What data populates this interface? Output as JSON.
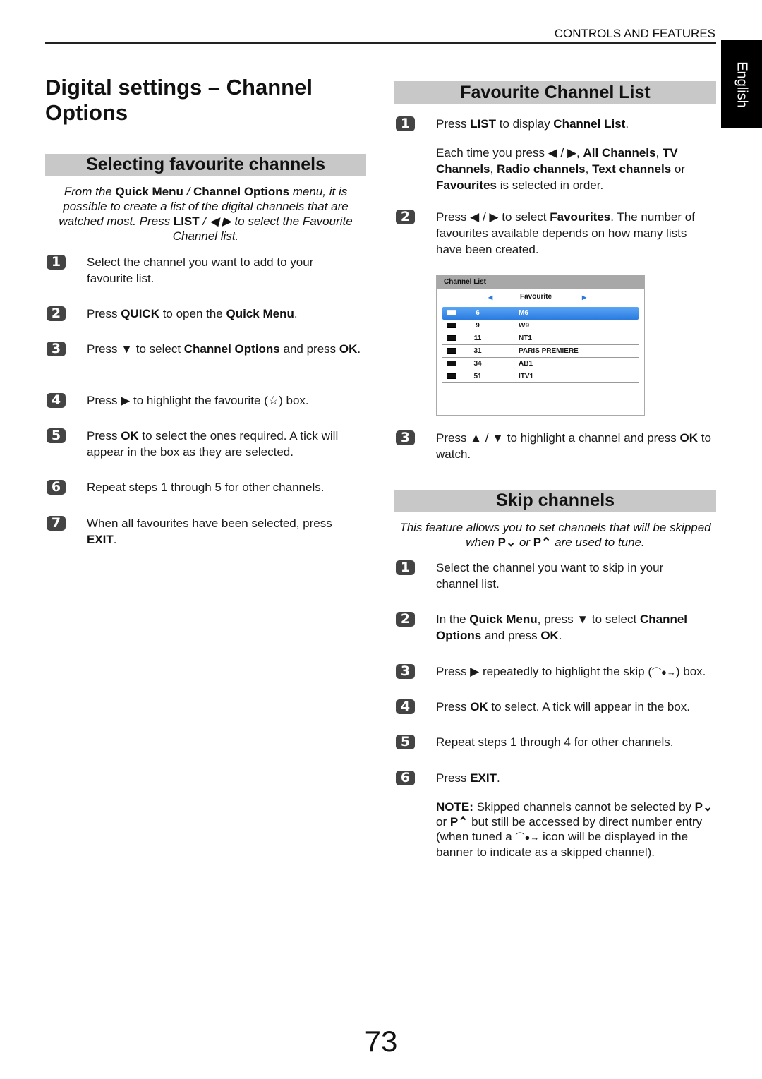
{
  "header": {
    "section_label": "CONTROLS AND FEATURES",
    "language_tab": "English"
  },
  "page_title": "Digital settings – Channel Options",
  "left": {
    "heading": "Selecting favourite channels",
    "intro": {
      "p1": "From the ",
      "b1": "Quick Menu",
      "p2": " / ",
      "b2": "Channel Options",
      "p3": " menu, it is possible to create a list of the digital channels that are watched most. Press ",
      "b3": "LIST",
      "p4": " / ◀ ▶ to select the Favourite Channel list."
    },
    "steps": [
      {
        "n": "1",
        "text": "Select the channel you want to add to your favourite list."
      },
      {
        "n": "2",
        "p1": "Press ",
        "b1": "QUICK",
        "p2": " to open the ",
        "b2": "Quick Menu",
        "p3": "."
      },
      {
        "n": "3",
        "p1": "Press ▼ to select ",
        "b1": "Channel Options",
        "p2": " and press ",
        "b2": "OK",
        "p3": "."
      },
      {
        "n": "4",
        "text": "Press ▶ to highlight the favourite (☆) box."
      },
      {
        "n": "5",
        "p1": "Press ",
        "b1": "OK",
        "p2": " to select the ones required. A tick will appear in the box as they are selected."
      },
      {
        "n": "6",
        "text": "Repeat steps 1 through 5 for other channels."
      },
      {
        "n": "7",
        "p1": "When all favourites have been selected, press ",
        "b1": "EXIT",
        "p2": "."
      }
    ]
  },
  "favourite": {
    "heading": "Favourite Channel List",
    "steps": [
      {
        "n": "1",
        "p1": "Press ",
        "b1": "LIST",
        "p2": " to display ",
        "b2": "Channel List",
        "p3": "."
      },
      {
        "extra": true,
        "p1": "Each time you press ◀ / ▶, ",
        "b1": "All Channels",
        "p2": ", ",
        "b2": "TV Channels",
        "p3": ", ",
        "b3": "Radio channels",
        "p4": ", ",
        "b4": "Text channels",
        "p5": " or ",
        "b5": "Favourites",
        "p6": " is selected in order."
      },
      {
        "n": "2",
        "p1": "Press ◀ / ▶ to select ",
        "b1": "Favourites",
        "p2": ". The number of favourites available depends on how many lists have been created."
      },
      {
        "n": "3",
        "p1": "Press ▲ / ▼ to highlight a channel and press ",
        "b1": "OK",
        "p2": " to watch."
      }
    ],
    "channel_list": {
      "title": "Channel List",
      "filter": "Favourite",
      "rows": [
        {
          "number": "6",
          "name": "M6",
          "selected": true
        },
        {
          "number": "9",
          "name": "W9"
        },
        {
          "number": "11",
          "name": "NT1"
        },
        {
          "number": "31",
          "name": "PARIS PREMIERE"
        },
        {
          "number": "34",
          "name": "AB1"
        },
        {
          "number": "51",
          "name": "ITV1"
        }
      ]
    }
  },
  "skip": {
    "heading": "Skip channels",
    "intro": {
      "p1": "This feature allows you to set channels that will be skipped when ",
      "b1": "P⌄",
      "p2": " or ",
      "b2": "P⌃",
      "p3": " are used to tune."
    },
    "steps": [
      {
        "n": "1",
        "text": "Select the channel you want to skip in your channel list."
      },
      {
        "n": "2",
        "p1": "In the ",
        "b1": "Quick Menu",
        "p2": ", press ▼ to select ",
        "b2": "Channel Options",
        "p3": " and press ",
        "b3": "OK",
        "p4": "."
      },
      {
        "n": "3",
        "p1": "Press ▶ repeatedly to highlight the skip (",
        "icon": "skip-icon",
        "p2": ") box."
      },
      {
        "n": "4",
        "p1": "Press ",
        "b1": "OK",
        "p2": " to select. A tick will appear in the box."
      },
      {
        "n": "5",
        "text": "Repeat steps 1 through 4 for other channels."
      },
      {
        "n": "6",
        "p1": "Press ",
        "b1": "EXIT",
        "p2": "."
      }
    ],
    "note": {
      "label": "NOTE:",
      "p1": " Skipped channels cannot be selected by ",
      "b1": "P⌄",
      "p2": " or ",
      "b2": "P⌃",
      "p3": " but still be accessed by direct number entry (when tuned a ",
      "p4": " icon will be displayed in the banner to indicate as a skipped channel)."
    }
  },
  "page_number": "73"
}
